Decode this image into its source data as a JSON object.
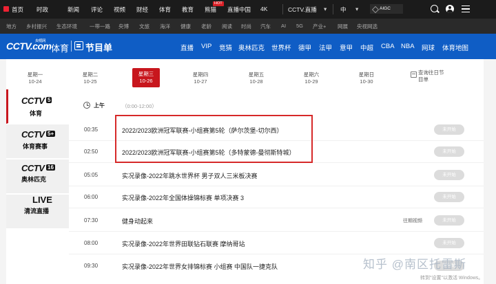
{
  "topbar": {
    "items": [
      "首页",
      "时政",
      "新闻",
      "评论",
      "视频",
      "财经",
      "体育",
      "教育",
      "熊猫",
      "直播中国",
      "4K"
    ],
    "hot_badge": "HOT",
    "select_channel": "CCTV.直播",
    "select_lang": "中",
    "aigc": "AIGC"
  },
  "subbar": {
    "items": [
      "地方",
      "乡村振兴",
      "生态环境",
      "一带一路",
      "央博",
      "文旅",
      "海洋",
      "健康",
      "老龄",
      "阅读",
      "时尚",
      "汽车",
      "AI",
      "5G",
      "产业+",
      "网展",
      "央视网选"
    ]
  },
  "header": {
    "logo": "CCTV.com",
    "logo_small": "央视网",
    "channel": "体育",
    "program_title": "节目单",
    "nav": [
      "直播",
      "VIP",
      "竞猜",
      "奥林匹克",
      "世界杯",
      "德甲",
      "法甲",
      "意甲",
      "中超",
      "CBA",
      "NBA",
      "网球",
      "体育地图"
    ]
  },
  "dates": [
    {
      "day": "星期一",
      "date": "10-24"
    },
    {
      "day": "星期二",
      "date": "10-25"
    },
    {
      "day": "星期三",
      "date": "10-26"
    },
    {
      "day": "星期四",
      "date": "10-27"
    },
    {
      "day": "星期五",
      "date": "10-28"
    },
    {
      "day": "星期六",
      "date": "10-29"
    },
    {
      "day": "星期日",
      "date": "10-30"
    }
  ],
  "past_query": "查询往日节目单",
  "channels": [
    {
      "logo": "CCTV",
      "num": "5",
      "sub": "体育"
    },
    {
      "logo": "CCTV",
      "num": "5+",
      "sub": "体育赛事"
    },
    {
      "logo": "CCTV",
      "num": "16",
      "sub": "奥林匹克"
    },
    {
      "logo": "LIVE",
      "sub": "清流直播"
    }
  ],
  "period": {
    "label": "上午",
    "range": "（0:00-12:00）"
  },
  "schedule": [
    {
      "time": "00:35",
      "title": "2022/2023欧洲冠军联赛-小组赛第5轮（萨尔茨堡-切尔西）",
      "extra": "",
      "btn": "未开始"
    },
    {
      "time": "02:50",
      "title": "2022/2023欧洲冠军联赛-小组赛第5轮（多特蒙德-曼彻斯特城）",
      "extra": "",
      "btn": "未开始"
    },
    {
      "time": "05:05",
      "title": "实况录像-2022年跳水世界杯 男子双人三米板决赛",
      "extra": "",
      "btn": "未开始"
    },
    {
      "time": "06:00",
      "title": "实况录像-2022年全国体操锦标赛 单项决赛 3",
      "extra": "",
      "btn": "未开始"
    },
    {
      "time": "07:30",
      "title": "健身动起来",
      "extra": "往期视频",
      "btn": "未开始"
    },
    {
      "time": "08:00",
      "title": "实况录像-2022年世界田联钻石联赛 摩纳哥站",
      "extra": "",
      "btn": "未开始"
    },
    {
      "time": "09:30",
      "title": "实况录像-2022年世界女排锦标赛 小组赛 中国队一捷克队",
      "extra": "",
      "btn": "未开始"
    }
  ],
  "watermark": "知乎 @南区托雷斯",
  "win_activate": "转到\"设置\"以激活 Windows。"
}
